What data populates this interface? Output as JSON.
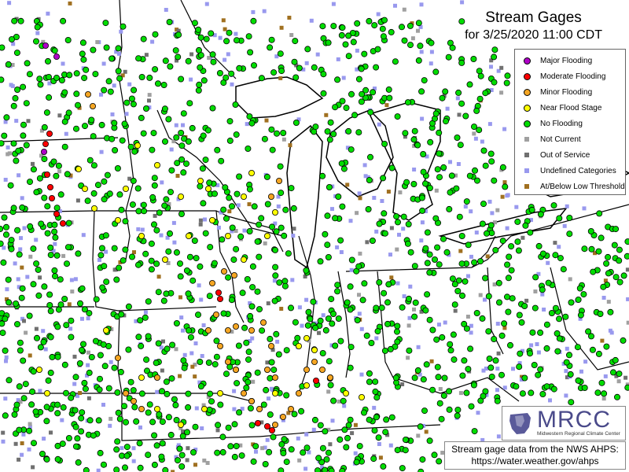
{
  "title": "Stream Gages",
  "subtitle": "for 3/25/2020 11:00 CDT",
  "legend": [
    {
      "label": "Major Flooding",
      "shape": "circle",
      "color": "#b000c8"
    },
    {
      "label": "Moderate Flooding",
      "shape": "circle",
      "color": "#ff0000"
    },
    {
      "label": "Minor Flooding",
      "shape": "circle",
      "color": "#f5a623"
    },
    {
      "label": "Near Flood Stage",
      "shape": "circle",
      "color": "#ffff00"
    },
    {
      "label": "No Flooding",
      "shape": "circle",
      "color": "#00dd00"
    },
    {
      "label": "Not Current",
      "shape": "square",
      "color": "#a0a0a0"
    },
    {
      "label": "Out of Service",
      "shape": "square",
      "color": "#707070"
    },
    {
      "label": "Undefined Categories",
      "shape": "square",
      "color": "#9999ee"
    },
    {
      "label": "At/Below Low Threshold",
      "shape": "square",
      "color": "#a07020"
    }
  ],
  "logo": {
    "wordmark": "MRCC",
    "subtitle": "Midwestern Regional Climate Center"
  },
  "source": {
    "line1": "Stream gage data from the NWS AHPS:",
    "line2": "https://water.weather.gov/ahps"
  },
  "colors": {
    "border": "#000000",
    "gage_outline": "#000000"
  }
}
